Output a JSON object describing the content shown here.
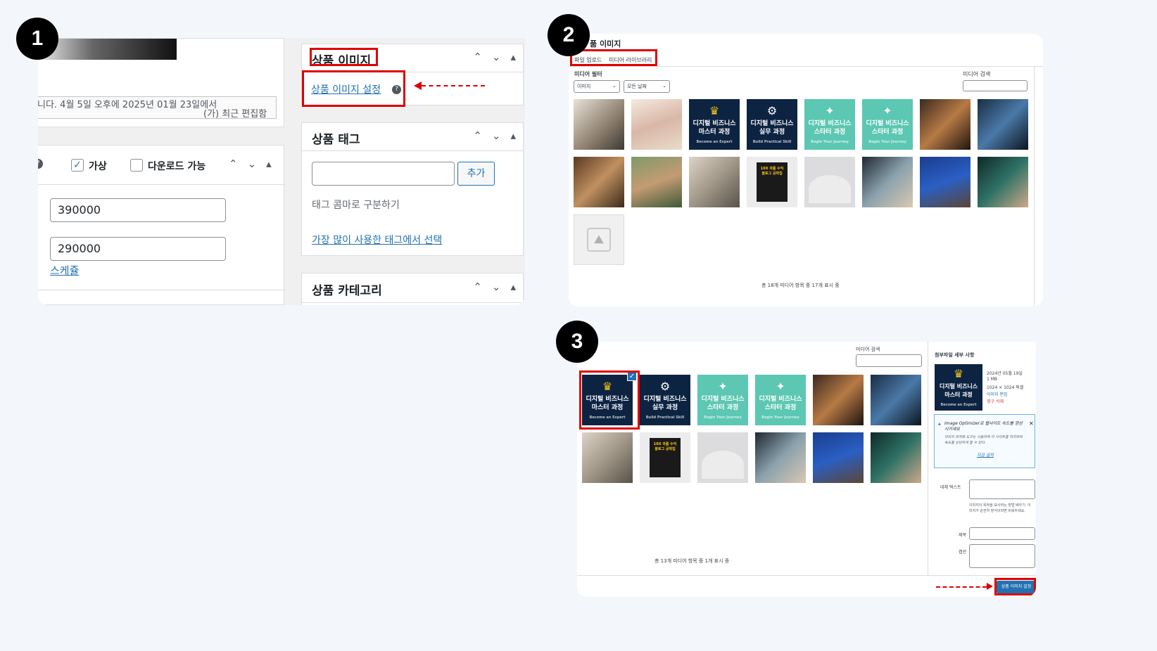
{
  "badges": [
    "1",
    "2",
    "3"
  ],
  "panel1": {
    "blurred_date_text": "니다. 4월 5일 오후에 2025년 01월 23일에서",
    "last_edited_text": "(가) 최근 편집함",
    "virtual_label": "가상",
    "downloadable_label": "다운로드 가능",
    "regular_price": "390000",
    "sale_price": "290000",
    "schedule_link": "스케쥴",
    "product_image_title": "상품 이미지",
    "set_product_image_link": "상품 이미지 설정",
    "product_tag_title": "상품 태그",
    "add_button": "추가",
    "tag_hint": "태그 콤마로 구분하기",
    "most_used_tags_link": "가장 많이 사용한 태그에서 선택",
    "product_category_title": "상품 카테고리"
  },
  "panel2": {
    "title": "품 이미지",
    "tab_upload": "파일 업로드",
    "tab_library": "미디어 라이브러리",
    "filter_label": "미디어 필터",
    "filter_type": "이미지",
    "filter_date": "모든 날짜",
    "search_label": "미디어 검색",
    "count_text": "총 18개 미디어 항목 중 17개 표시 중"
  },
  "panel3": {
    "search_label": "미디어 검색",
    "details_title": "첨부파일 세부 사항",
    "detail_date": "2024년 05월 19일",
    "detail_size": "1 MB",
    "detail_dims": "1024 × 1024 픽셀",
    "edit_image_link": "이미지 편집",
    "delete_link": "영구 삭제",
    "optimizer_text": "Image Optimizer로 웹사이트 속도를 향상시키세요",
    "optimizer_desc": "이미지 최적화 도구는 사용하여 이 사이트를 처리하여 속도를 상당하게 할 수 있다.",
    "install_link": "지금 설치",
    "alt_label": "대체 텍스트",
    "alt_help": "이미지의 목적을 묘사하는 방법 배우기. 이미지가 순전히 장식이라면 비워두세요.",
    "title_label": "제목",
    "caption_label": "캡션",
    "count_text": "총 13개 미디어 항목 중 1개 표시 중",
    "set_button": "상품 이미지 설정"
  },
  "thumbs": {
    "master": "디지털 비즈니스\n마스터 과정",
    "master_sub": "Become an Expert",
    "practice": "디지털 비즈니스\n실무 과정",
    "practice_sub": "Build Practical Skill",
    "starter": "디지털 비즈니스\n스타터 과정",
    "starter_sub": "Begin Your Journey",
    "book": "10X 과를 수익 블로그 공략집"
  },
  "colors": {
    "accent_red": "#e00000",
    "wp_blue": "#2271b1",
    "navy": "#0d2342",
    "teal": "#5cc7b2"
  }
}
